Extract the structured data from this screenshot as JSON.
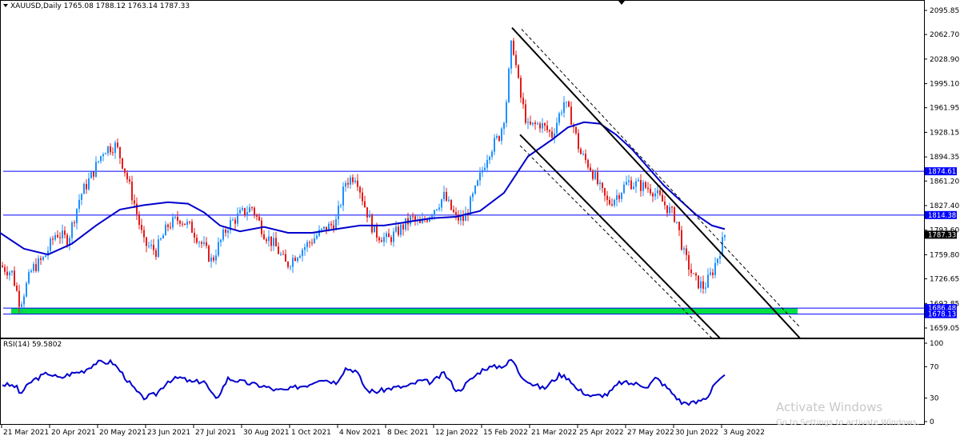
{
  "header": {
    "title": "XAUUSD,Daily  1765.08 1788.12 1763.14 1787.33",
    "rsi_title": "RSI(14) 59.5802"
  },
  "watermark": {
    "line1": "Activate Windows",
    "line2": "Go to Settings to activate Windows."
  },
  "colors": {
    "bull": "#1e90ff",
    "bear": "#e31b1b",
    "ma": "#0000cc",
    "hline": "#0000ff",
    "support_zone": "#00e040",
    "channel": "#000000",
    "rsi": "#0000cc"
  },
  "chart_data": [
    {
      "type": "candlestick",
      "symbol": "XAUUSD",
      "timeframe": "Daily",
      "ohlc_last": {
        "open": 1765.08,
        "high": 1788.12,
        "low": 1763.14,
        "close": 1787.33
      },
      "ylim": [
        1645,
        2105
      ],
      "y_ticks": [
        "2095.85",
        "2062.70",
        "2028.90",
        "1995.10",
        "1961.95",
        "1928.15",
        "1894.35",
        "1861.20",
        "1827.40",
        "1793.60",
        "1759.80",
        "1726.65",
        "1692.85",
        "1659.05"
      ],
      "x_ticks": [
        "21 Mar 2021",
        "20 Apr 2021",
        "20 May 2021",
        "23 Jun 2021",
        "27 Jul 2021",
        "30 Aug 2021",
        "1 Oct 2021",
        "4 Nov 2021",
        "8 Dec 2021",
        "12 Jan 2022",
        "15 Feb 2022",
        "21 Mar 2022",
        "25 Apr 2022",
        "27 May 2022",
        "30 Jun 2022",
        "3 Aug 2022"
      ],
      "price_path": [
        [
          0,
          1745
        ],
        [
          15,
          1735
        ],
        [
          25,
          1692
        ],
        [
          40,
          1740
        ],
        [
          55,
          1755
        ],
        [
          70,
          1790
        ],
        [
          85,
          1780
        ],
        [
          100,
          1840
        ],
        [
          115,
          1870
        ],
        [
          130,
          1905
        ],
        [
          145,
          1910
        ],
        [
          155,
          1880
        ],
        [
          168,
          1830
        ],
        [
          180,
          1775
        ],
        [
          195,
          1765
        ],
        [
          210,
          1800
        ],
        [
          225,
          1810
        ],
        [
          240,
          1795
        ],
        [
          255,
          1770
        ],
        [
          265,
          1750
        ],
        [
          270,
          1765
        ],
        [
          285,
          1800
        ],
        [
          300,
          1815
        ],
        [
          315,
          1825
        ],
        [
          330,
          1790
        ],
        [
          345,
          1770
        ],
        [
          358,
          1745
        ],
        [
          370,
          1760
        ],
        [
          385,
          1775
        ],
        [
          400,
          1790
        ],
        [
          420,
          1805
        ],
        [
          432,
          1860
        ],
        [
          445,
          1870
        ],
        [
          455,
          1830
        ],
        [
          468,
          1790
        ],
        [
          485,
          1780
        ],
        [
          500,
          1795
        ],
        [
          515,
          1810
        ],
        [
          525,
          1800
        ],
        [
          540,
          1820
        ],
        [
          555,
          1840
        ],
        [
          570,
          1810
        ],
        [
          580,
          1808
        ],
        [
          595,
          1850
        ],
        [
          610,
          1900
        ],
        [
          625,
          1925
        ],
        [
          632,
          1960
        ],
        [
          640,
          2058
        ],
        [
          650,
          1980
        ],
        [
          660,
          1935
        ],
        [
          675,
          1940
        ],
        [
          690,
          1925
        ],
        [
          705,
          1970
        ],
        [
          715,
          1945
        ],
        [
          725,
          1900
        ],
        [
          738,
          1880
        ],
        [
          750,
          1850
        ],
        [
          760,
          1830
        ],
        [
          770,
          1840
        ],
        [
          785,
          1860
        ],
        [
          800,
          1855
        ],
        [
          815,
          1850
        ],
        [
          830,
          1830
        ],
        [
          845,
          1810
        ],
        [
          855,
          1760
        ],
        [
          868,
          1725
        ],
        [
          880,
          1715
        ],
        [
          890,
          1735
        ],
        [
          898,
          1760
        ],
        [
          906,
          1787
        ]
      ],
      "moving_average": {
        "name": "MA",
        "path": [
          [
            0,
            1790
          ],
          [
            30,
            1768
          ],
          [
            60,
            1760
          ],
          [
            90,
            1775
          ],
          [
            120,
            1800
          ],
          [
            150,
            1822
          ],
          [
            180,
            1828
          ],
          [
            210,
            1832
          ],
          [
            235,
            1830
          ],
          [
            255,
            1818
          ],
          [
            275,
            1800
          ],
          [
            300,
            1792
          ],
          [
            330,
            1798
          ],
          [
            360,
            1790
          ],
          [
            390,
            1790
          ],
          [
            420,
            1795
          ],
          [
            450,
            1800
          ],
          [
            480,
            1800
          ],
          [
            510,
            1805
          ],
          [
            540,
            1810
          ],
          [
            570,
            1812
          ],
          [
            600,
            1820
          ],
          [
            630,
            1845
          ],
          [
            660,
            1895
          ],
          [
            690,
            1918
          ],
          [
            710,
            1935
          ],
          [
            730,
            1942
          ],
          [
            750,
            1940
          ],
          [
            770,
            1925
          ],
          [
            790,
            1905
          ],
          [
            810,
            1880
          ],
          [
            830,
            1855
          ],
          [
            850,
            1835
          ],
          [
            870,
            1815
          ],
          [
            890,
            1800
          ],
          [
            906,
            1795
          ]
        ]
      },
      "horizontal_levels": [
        {
          "value": 1874.61,
          "label": "1874.61",
          "style": "line"
        },
        {
          "value": 1814.38,
          "label": "1814.38",
          "style": "line"
        },
        {
          "value": 1686.48,
          "label": "1686.48",
          "style": "line"
        },
        {
          "value": 1678.13,
          "label": "1678.13",
          "style": "line"
        },
        {
          "value": 1787.33,
          "label": "1787.33",
          "style": "current"
        }
      ],
      "support_zone": [
        1678.13,
        1686.48
      ],
      "channel_lines": [
        {
          "from": [
            640,
            2072
          ],
          "to": [
            1000,
            1645
          ],
          "dashed": false
        },
        {
          "from": [
            652,
            2070
          ],
          "to": [
            1000,
            1660
          ],
          "dashed": true
        },
        {
          "from": [
            650,
            1925
          ],
          "to": [
            900,
            1645
          ],
          "dashed": false
        },
        {
          "from": [
            650,
            1910
          ],
          "to": [
            890,
            1645
          ],
          "dashed": true
        }
      ]
    },
    {
      "type": "line",
      "name": "RSI(14)",
      "value": 59.5802,
      "ylim": [
        0,
        100
      ],
      "y_ticks": [
        "100",
        "70",
        "30",
        "0"
      ],
      "path": [
        [
          0,
          48
        ],
        [
          20,
          45
        ],
        [
          25,
          35
        ],
        [
          40,
          52
        ],
        [
          60,
          62
        ],
        [
          75,
          55
        ],
        [
          85,
          60
        ],
        [
          105,
          65
        ],
        [
          120,
          75
        ],
        [
          140,
          76
        ],
        [
          150,
          65
        ],
        [
          165,
          45
        ],
        [
          178,
          30
        ],
        [
          195,
          35
        ],
        [
          210,
          52
        ],
        [
          225,
          56
        ],
        [
          240,
          50
        ],
        [
          255,
          52
        ],
        [
          265,
          35
        ],
        [
          270,
          28
        ],
        [
          285,
          55
        ],
        [
          305,
          50
        ],
        [
          330,
          45
        ],
        [
          345,
          40
        ],
        [
          358,
          40
        ],
        [
          370,
          44
        ],
        [
          385,
          47
        ],
        [
          400,
          55
        ],
        [
          420,
          50
        ],
        [
          432,
          68
        ],
        [
          445,
          65
        ],
        [
          458,
          40
        ],
        [
          470,
          38
        ],
        [
          490,
          43
        ],
        [
          510,
          45
        ],
        [
          525,
          52
        ],
        [
          540,
          50
        ],
        [
          555,
          62
        ],
        [
          572,
          38
        ],
        [
          590,
          55
        ],
        [
          605,
          68
        ],
        [
          620,
          70
        ],
        [
          632,
          72
        ],
        [
          640,
          80
        ],
        [
          650,
          60
        ],
        [
          665,
          48
        ],
        [
          680,
          42
        ],
        [
          700,
          60
        ],
        [
          712,
          55
        ],
        [
          720,
          42
        ],
        [
          740,
          32
        ],
        [
          760,
          35
        ],
        [
          775,
          50
        ],
        [
          795,
          48
        ],
        [
          810,
          45
        ],
        [
          820,
          56
        ],
        [
          835,
          42
        ],
        [
          852,
          24
        ],
        [
          870,
          24
        ],
        [
          885,
          32
        ],
        [
          892,
          48
        ],
        [
          906,
          59.58
        ]
      ]
    }
  ]
}
